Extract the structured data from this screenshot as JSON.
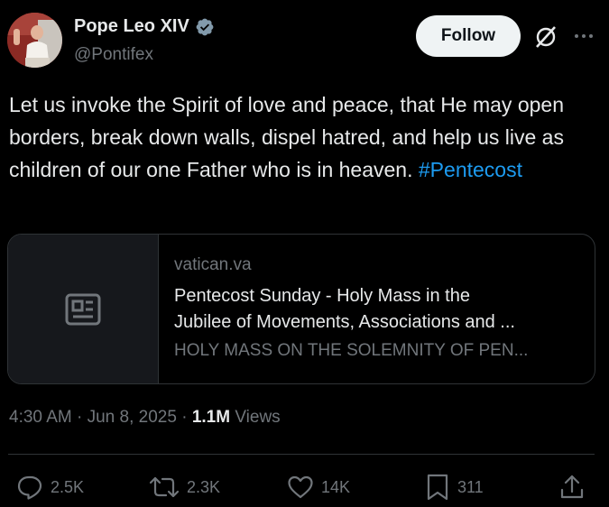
{
  "author": {
    "name": "Pope Leo XIV",
    "handle": "@Pontifex",
    "verified": true,
    "avatar_icon": "profile-photo"
  },
  "header": {
    "follow_label": "Follow",
    "grok_icon": "grok-icon",
    "more_icon": "more-dots-icon"
  },
  "post": {
    "text": "Let us invoke the Spirit of love and peace, that He may open borders, break down walls, dispel hatred, and help us live as children of our one Father who is in heaven.",
    "hashtag": "#Pentecost"
  },
  "link_card": {
    "domain": "vatican.va",
    "title_line1": "Pentecost Sunday - Holy Mass in the",
    "title_line2": "Jubilee of Movements, Associations and ...",
    "description": "HOLY MASS ON THE SOLEMNITY OF PEN...",
    "thumb_icon": "article-icon"
  },
  "meta": {
    "time": "4:30 AM",
    "date": "Jun 8, 2025",
    "views_count": "1.1M",
    "views_label": "Views"
  },
  "actions": {
    "replies": "2.5K",
    "reposts": "2.3K",
    "likes": "14K",
    "bookmarks": "311"
  },
  "colors": {
    "background": "#000000",
    "text": "#e7e9ea",
    "secondary": "#71767b",
    "link": "#1d9bf0",
    "border": "#2f3336"
  }
}
